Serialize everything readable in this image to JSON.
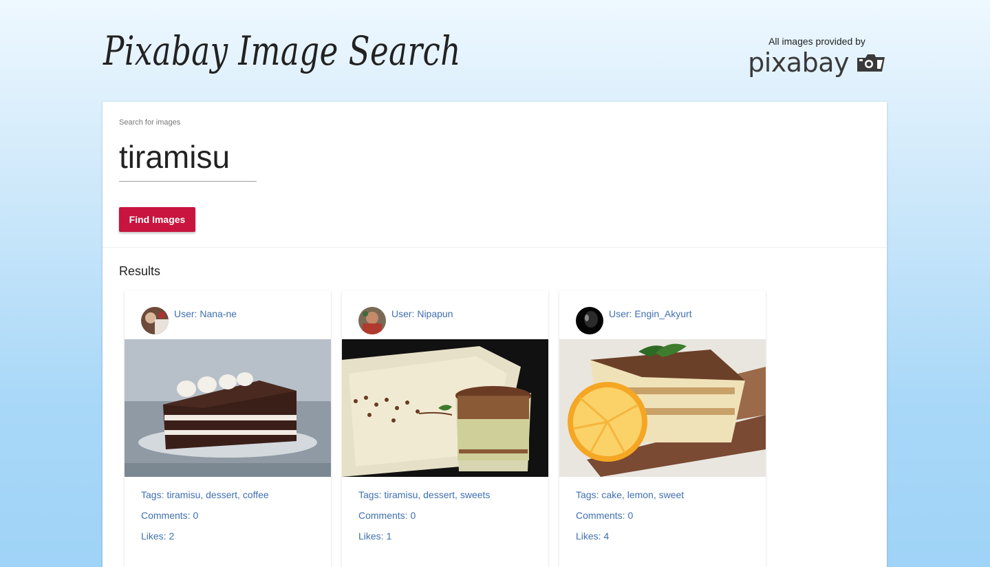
{
  "header": {
    "title": "Pixabay Image Search",
    "provider_caption": "All images provided by",
    "provider_logo_text": "pixabay"
  },
  "search": {
    "label": "Search for images",
    "value": "tiramisu",
    "button_label": "Find Images"
  },
  "results": {
    "heading": "Results",
    "cards": [
      {
        "user": "User: Nana-ne",
        "tags": "Tags: tiramisu, dessert, coffee",
        "comments": "Comments: 0",
        "likes": "Likes: 2"
      },
      {
        "user": "User: Nipapun",
        "tags": "Tags: tiramisu, dessert, sweets",
        "comments": "Comments: 0",
        "likes": "Likes: 1"
      },
      {
        "user": "User: Engin_Akyurt",
        "tags": "Tags: cake, lemon, sweet",
        "comments": "Comments: 0",
        "likes": "Likes: 4"
      }
    ]
  },
  "colors": {
    "accent": "#c8143f",
    "link": "#3f6fb0"
  }
}
